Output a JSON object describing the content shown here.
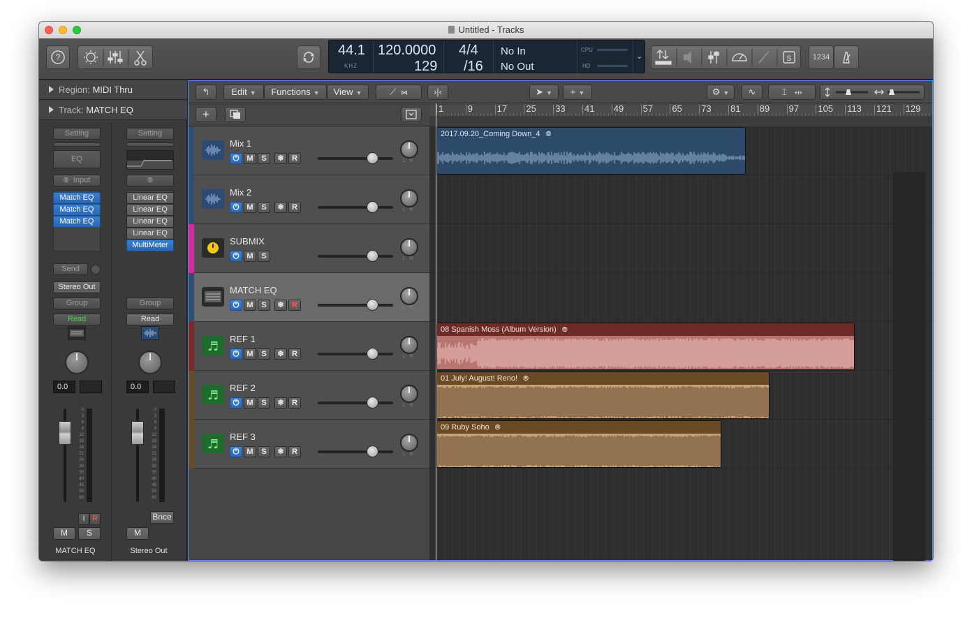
{
  "window": {
    "title": "Untitled - Tracks"
  },
  "control_bar": {
    "help_icon": "?",
    "lcd": {
      "sample_rate": "44.1",
      "sample_rate_unit": "KHZ",
      "tempo": "120.0000",
      "bar": "129",
      "time_sig_top": "4/4",
      "time_sig_bottom": "/16",
      "midi_in": "No In",
      "midi_out": "No Out",
      "cpu_label": "CPU",
      "hd_label": "HD"
    },
    "count_in": "1234"
  },
  "inspector": {
    "region_label": "Region:",
    "region_value": "MIDI Thru",
    "track_label": "Track:",
    "track_value": "MATCH EQ",
    "strip1": {
      "setting": "Setting",
      "eq": "EQ",
      "input": "Input",
      "plugins": [
        "Match EQ",
        "Match EQ",
        "Match EQ"
      ],
      "send": "Send",
      "output": "Stereo Out",
      "group": "Group",
      "automation": "Read",
      "value": "0.0",
      "i_label": "I",
      "r_label": "R",
      "mute": "M",
      "solo": "S",
      "name": "MATCH EQ"
    },
    "strip2": {
      "setting": "Setting",
      "plugins": [
        "Linear EQ",
        "Linear EQ",
        "Linear EQ",
        "Linear EQ",
        "MultiMeter"
      ],
      "group": "Group",
      "automation": "Read",
      "value": "0.0",
      "bounce": "Bnce",
      "mute": "M",
      "name": "Stereo Out"
    },
    "meter_scale": [
      "0",
      "3",
      "6",
      "9",
      "12",
      "15",
      "18",
      "21",
      "24",
      "30",
      "35",
      "40",
      "45",
      "50",
      "60"
    ]
  },
  "toolbar": {
    "edit": "Edit",
    "functions": "Functions",
    "view": "View"
  },
  "ruler": [
    "1",
    "9",
    "17",
    "25",
    "33",
    "41",
    "49",
    "57",
    "65",
    "73",
    "81",
    "89",
    "97",
    "105",
    "113",
    "121",
    "129"
  ],
  "tracks": [
    {
      "name": "Mix 1",
      "color": "#2f4d6e",
      "has_freeze": true,
      "has_r": true,
      "icon": "audio-waveform-icon"
    },
    {
      "name": "Mix 2",
      "color": "#2f4d6e",
      "has_freeze": true,
      "has_r": true,
      "icon": "audio-waveform-icon"
    },
    {
      "name": "SUBMIX",
      "color": "#d22aa0",
      "has_freeze": false,
      "has_r": false,
      "icon": "aux-yellow-icon"
    },
    {
      "name": "MATCH EQ",
      "color": "#2f4d6e",
      "has_freeze": true,
      "has_r": true,
      "icon": "plugin-icon"
    },
    {
      "name": "REF 1",
      "color": "#7a2a22",
      "has_freeze": true,
      "has_r": true,
      "icon": "music-note-icon"
    },
    {
      "name": "REF 2",
      "color": "#6a4a24",
      "has_freeze": true,
      "has_r": true,
      "icon": "music-note-icon"
    },
    {
      "name": "REF 3",
      "color": "#6a4a24",
      "has_freeze": true,
      "has_r": true,
      "icon": "music-note-icon"
    }
  ],
  "track_buttons": {
    "mute": "M",
    "solo": "S",
    "record": "R"
  },
  "regions": [
    {
      "name": "2017.09.20_Coming Down_4",
      "track": 0,
      "fill": "#2d4a6a",
      "wave": "#9fb8d6",
      "label_color": "#dbe6f2"
    },
    {
      "name": "08 Spanish Moss (Album Version)",
      "track": 4,
      "fill": "#b8746e",
      "wave": "#f0c6c0",
      "label_color": "#f3e3e0",
      "header": "#6e2a24"
    },
    {
      "name": "01 July! August! Reno!",
      "track": 5,
      "fill": "#c6a27a",
      "wave": "#5e4225",
      "label_color": "#f2e6d6",
      "header": "#6a4a24"
    },
    {
      "name": "09 Ruby Soho",
      "track": 6,
      "fill": "#c6a27a",
      "wave": "#5e4225",
      "label_color": "#f2e6d6",
      "header": "#6a4a24"
    }
  ]
}
